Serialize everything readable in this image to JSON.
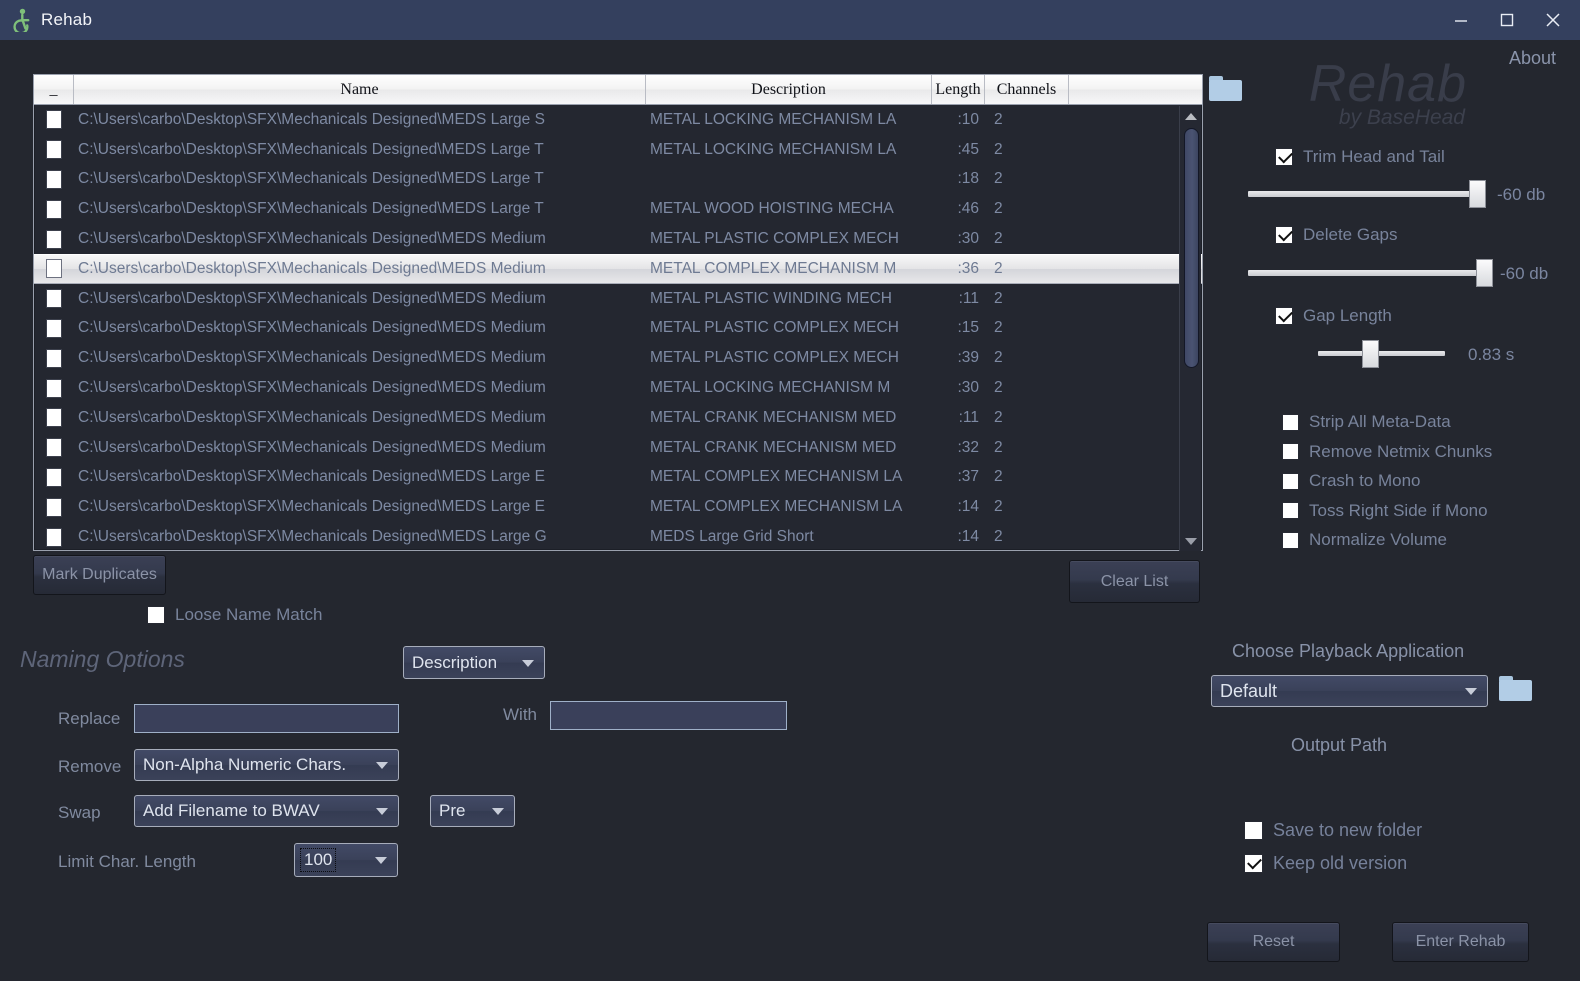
{
  "window": {
    "title": "Rehab",
    "icon": "accessibility-icon",
    "controls": {
      "minimize": "—",
      "maximize": "□",
      "close": "✕"
    }
  },
  "branding": {
    "about_label": "About",
    "logo": "Rehab",
    "logo_sub": "by BaseHead"
  },
  "file_list": {
    "columns": [
      "_",
      "Name",
      "Description",
      "Length",
      "Channels",
      ""
    ],
    "rows": [
      {
        "name": "C:\\Users\\carbo\\Desktop\\SFX\\Mechanicals Designed\\MEDS Large S",
        "description": "METAL LOCKING MECHANISM LA",
        "length": ":10",
        "channels": "2",
        "checked": false,
        "selected": false
      },
      {
        "name": "C:\\Users\\carbo\\Desktop\\SFX\\Mechanicals Designed\\MEDS Large T",
        "description": "METAL LOCKING MECHANISM LA",
        "length": ":45",
        "channels": "2",
        "checked": false,
        "selected": false
      },
      {
        "name": "C:\\Users\\carbo\\Desktop\\SFX\\Mechanicals Designed\\MEDS Large T",
        "description": "",
        "length": ":18",
        "channels": "2",
        "checked": false,
        "selected": false
      },
      {
        "name": "C:\\Users\\carbo\\Desktop\\SFX\\Mechanicals Designed\\MEDS Large T",
        "description": "METAL WOOD HOISTING MECHA",
        "length": ":46",
        "channels": "2",
        "checked": false,
        "selected": false
      },
      {
        "name": "C:\\Users\\carbo\\Desktop\\SFX\\Mechanicals Designed\\MEDS Medium",
        "description": "METAL PLASTIC COMPLEX MECH",
        "length": ":30",
        "channels": "2",
        "checked": false,
        "selected": false
      },
      {
        "name": "C:\\Users\\carbo\\Desktop\\SFX\\Mechanicals Designed\\MEDS Medium",
        "description": "METAL COMPLEX MECHANISM M",
        "length": ":36",
        "channels": "2",
        "checked": false,
        "selected": true
      },
      {
        "name": "C:\\Users\\carbo\\Desktop\\SFX\\Mechanicals Designed\\MEDS Medium",
        "description": "METAL PLASTIC WINDING MECH",
        "length": ":11",
        "channels": "2",
        "checked": false,
        "selected": false
      },
      {
        "name": "C:\\Users\\carbo\\Desktop\\SFX\\Mechanicals Designed\\MEDS Medium",
        "description": "METAL PLASTIC COMPLEX MECH",
        "length": ":15",
        "channels": "2",
        "checked": false,
        "selected": false
      },
      {
        "name": "C:\\Users\\carbo\\Desktop\\SFX\\Mechanicals Designed\\MEDS Medium",
        "description": "METAL PLASTIC COMPLEX MECH",
        "length": ":39",
        "channels": "2",
        "checked": false,
        "selected": false
      },
      {
        "name": "C:\\Users\\carbo\\Desktop\\SFX\\Mechanicals Designed\\MEDS Medium",
        "description": "METAL LOCKING MECHANISM M",
        "length": ":30",
        "channels": "2",
        "checked": false,
        "selected": false
      },
      {
        "name": "C:\\Users\\carbo\\Desktop\\SFX\\Mechanicals Designed\\MEDS Medium",
        "description": "METAL CRANK MECHANISM MED",
        "length": ":11",
        "channels": "2",
        "checked": false,
        "selected": false
      },
      {
        "name": "C:\\Users\\carbo\\Desktop\\SFX\\Mechanicals Designed\\MEDS Medium",
        "description": "METAL CRANK MECHANISM MED",
        "length": ":32",
        "channels": "2",
        "checked": false,
        "selected": false
      },
      {
        "name": "C:\\Users\\carbo\\Desktop\\SFX\\Mechanicals Designed\\MEDS Large E",
        "description": "METAL COMPLEX MECHANISM LA",
        "length": ":37",
        "channels": "2",
        "checked": false,
        "selected": false
      },
      {
        "name": "C:\\Users\\carbo\\Desktop\\SFX\\Mechanicals Designed\\MEDS Large E",
        "description": "METAL COMPLEX MECHANISM LA",
        "length": ":14",
        "channels": "2",
        "checked": false,
        "selected": false
      },
      {
        "name": "C:\\Users\\carbo\\Desktop\\SFX\\Mechanicals Designed\\MEDS Large G",
        "description": "MEDS Large Grid Short",
        "length": ":14",
        "channels": "2",
        "checked": false,
        "selected": false
      }
    ]
  },
  "list_actions": {
    "mark_duplicates": "Mark Duplicates",
    "clear_list": "Clear List",
    "loose_name_match": {
      "label": "Loose Name Match",
      "checked": false
    }
  },
  "naming_options": {
    "title": "Naming Options",
    "target_field": "Description",
    "replace_label": "Replace",
    "replace_value": "",
    "with_label": "With",
    "with_value": "",
    "remove_label": "Remove",
    "remove_value": "Non-Alpha Numeric Chars.",
    "swap_label": "Swap",
    "swap_value": "Add Filename to BWAV",
    "swap_position": "Pre",
    "limit_label": "Limit Char. Length",
    "limit_value": "100"
  },
  "processing": {
    "trim": {
      "label": "Trim Head and Tail",
      "checked": true,
      "value": "-60 db"
    },
    "delete_gaps": {
      "label": "Delete Gaps",
      "checked": true,
      "value": "-60 db"
    },
    "gap_length": {
      "label": "Gap Length",
      "checked": true,
      "value": "0.83 s"
    },
    "options": [
      {
        "label": "Strip All Meta-Data",
        "checked": false
      },
      {
        "label": "Remove Netmix Chunks",
        "checked": false
      },
      {
        "label": "Crash to Mono",
        "checked": false
      },
      {
        "label": "Toss Right Side if Mono",
        "checked": false
      },
      {
        "label": "Normalize Volume",
        "checked": false
      }
    ]
  },
  "output": {
    "playback_label": "Choose Playback Application",
    "playback_value": "Default",
    "output_path_label": "Output Path",
    "output_path_value": "",
    "save_to_new_folder": {
      "label": "Save to new folder",
      "checked": false
    },
    "keep_old_version": {
      "label": "Keep old version",
      "checked": true
    }
  },
  "actions": {
    "reset": "Reset",
    "enter_rehab": "Enter Rehab"
  },
  "colors": {
    "titlebar": "#34405e",
    "background": "#24272f",
    "accent_text": "#78839b",
    "icon_green": "#7fc07a",
    "folder_blue": "#b2cde6"
  }
}
